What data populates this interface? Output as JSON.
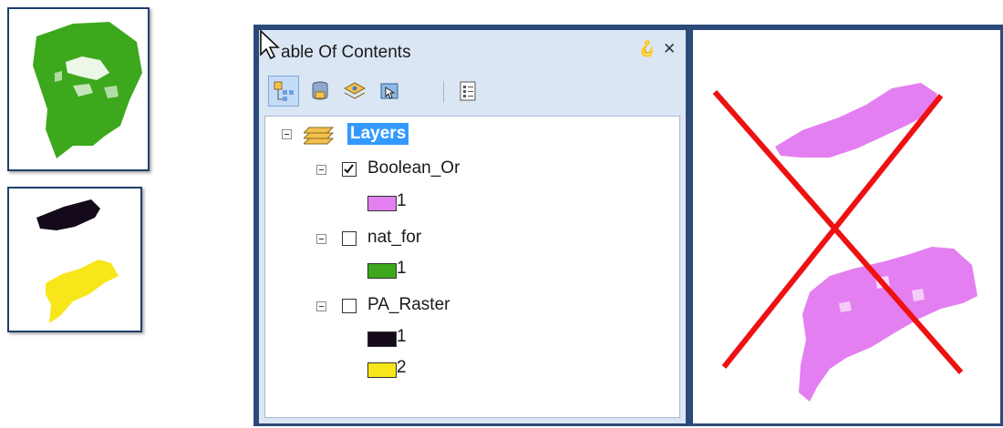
{
  "toc": {
    "title": "Table Of Contents",
    "title_visible": "able Of Contents",
    "pin_glyph": "Ρ",
    "close_glyph": "✕"
  },
  "toolbar": {
    "buttons": [
      "list-by-drawing-order-icon",
      "list-by-source-icon",
      "list-by-visibility-icon",
      "list-by-selection-icon",
      "options-icon"
    ]
  },
  "tree": {
    "root_label": "Layers",
    "layers": [
      {
        "name": "Boolean_Or",
        "checked": true,
        "legend": [
          {
            "value": "1",
            "color": "#e37ff0"
          }
        ]
      },
      {
        "name": "nat_for",
        "checked": false,
        "legend": [
          {
            "value": "1",
            "color": "#3da81c"
          }
        ]
      },
      {
        "name": "PA_Raster",
        "checked": false,
        "legend": [
          {
            "value": "1",
            "color": "#140a1a"
          },
          {
            "value": "2",
            "color": "#f7e61a"
          }
        ]
      }
    ]
  },
  "colors": {
    "window_border": "#2b4a78",
    "panel_bg": "#dbe6f4",
    "selection": "#3399ff",
    "forest_green": "#3da81c",
    "raster_black": "#140a1a",
    "raster_yellow": "#f7e61a",
    "boolean_pink": "#e37ff0",
    "cross_red": "#ee1111"
  }
}
